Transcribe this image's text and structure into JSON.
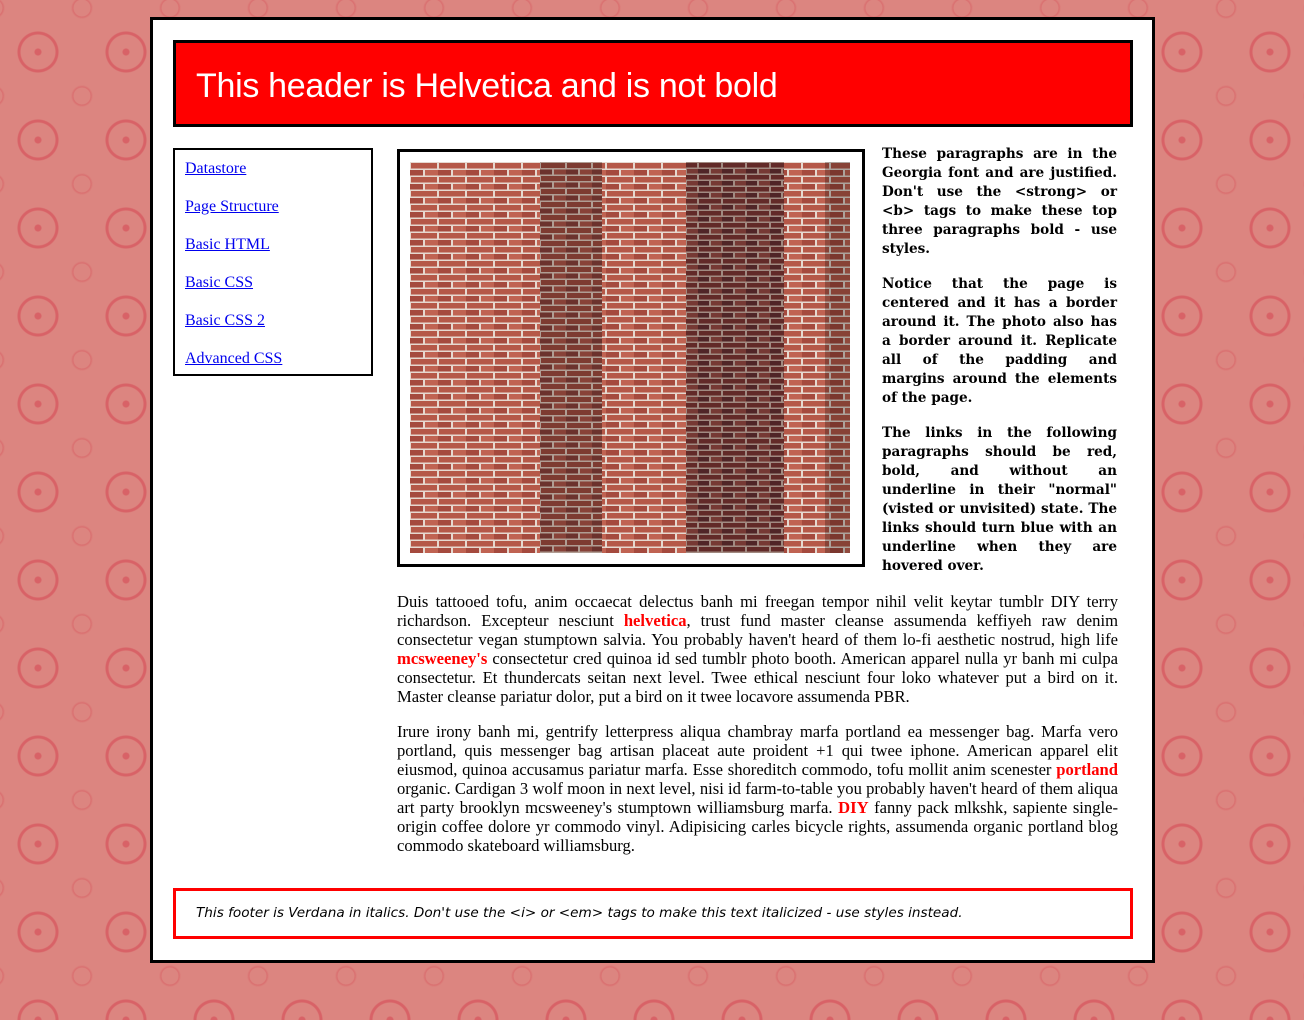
{
  "header": {
    "title": "This header is Helvetica and is not bold"
  },
  "nav": {
    "items": [
      {
        "label": "Datastore"
      },
      {
        "label": "Page Structure"
      },
      {
        "label": "Basic HTML"
      },
      {
        "label": "Basic CSS"
      },
      {
        "label": "Basic CSS 2"
      },
      {
        "label": "Advanced CSS"
      }
    ]
  },
  "photo": {
    "icon": "brick-wall-photo"
  },
  "intro": {
    "paragraphs": [
      "These paragraphs are in the Georgia font and are justified. Don't use the <strong> or <b> tags to make these top three paragraphs bold - use styles.",
      "Notice that the page is centered and it has a border around it. The photo also has a border around it. Replicate all of the padding and margins around the elements of the page.",
      "The links in the following paragraphs should be red, bold, and without an underline in their \"normal\" (visted or unvisited) state. The links should turn blue with an underline when they are hovered over."
    ]
  },
  "body": {
    "p1": {
      "t1": "Duis tattooed tofu, anim occaecat delectus banh mi freegan tempor nihil velit keytar tumblr DIY terry richardson. Excepteur nesciunt ",
      "link1": "helvetica",
      "t2": ", trust fund master cleanse assumenda keffiyeh raw denim consectetur vegan stumptown salvia. You probably haven't heard of them lo-fi aesthetic nostrud, high life ",
      "link2": "mcsweeney's",
      "t3": " consectetur cred quinoa id sed tumblr photo booth. American apparel nulla yr banh mi culpa consectetur. Et thundercats seitan next level. Twee ethical nesciunt four loko whatever put a bird on it. Master cleanse pariatur dolor, put a bird on it twee locavore assumenda PBR."
    },
    "p2": {
      "t1": "Irure irony banh mi, gentrify letterpress aliqua chambray marfa portland ea messenger bag. Marfa vero portland, quis messenger bag artisan placeat aute proident +1 qui twee iphone. American apparel elit eiusmod, quinoa accusamus pariatur marfa. Esse shoreditch commodo, tofu mollit anim scenester ",
      "link1": "portland",
      "t2": " organic. Cardigan 3 wolf moon in next level, nisi id farm-to-table you probably haven't heard of them aliqua art party brooklyn mcsweeney's stumptown williamsburg marfa. ",
      "link2": "DIY",
      "t3": " fanny pack mlkshk, sapiente single-origin coffee dolore yr commodo vinyl. Adipisicing carles bicycle rights, assumenda organic portland blog commodo skateboard williamsburg."
    }
  },
  "footer": {
    "text": "This footer is Verdana in italics. Don't use the <i> or <em> tags to make this text italicized - use styles instead."
  },
  "colors": {
    "accent": "#ff0000",
    "link_nav": "#0000ee",
    "background": "#dc8580"
  }
}
